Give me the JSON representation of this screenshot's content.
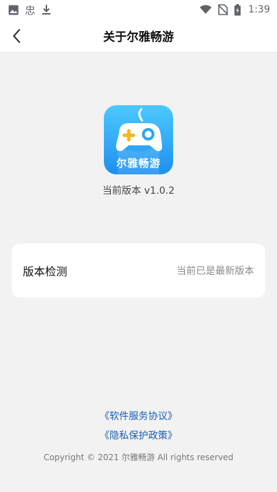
{
  "status_bar": {
    "time": "1:39",
    "left_icons": [
      "image-icon",
      "app-notification-icon",
      "download-icon"
    ],
    "right_icons": [
      "wifi-icon",
      "no-sim-icon",
      "battery-icon"
    ],
    "app_glyph": "忠"
  },
  "header": {
    "title": "关于尔雅畅游",
    "back_icon": "chevron-left-icon"
  },
  "app": {
    "logo_text": "尔雅畅游",
    "version": "当前版本 v1.0.2",
    "logo_colors": {
      "top": "#4cc9ff",
      "bottom": "#1e8fef",
      "plus": "#f6b81c"
    }
  },
  "version_check": {
    "label": "版本检测",
    "value": "当前已是最新版本"
  },
  "footer": {
    "terms_link": "《软件服务协议》",
    "privacy_link": "《隐私保护政策》",
    "copyright": "Copyright © 2021 尔雅畅游 All rights reserved"
  },
  "colors": {
    "background": "#f2f2f2",
    "link": "#1a5fb4",
    "card": "#ffffff"
  }
}
